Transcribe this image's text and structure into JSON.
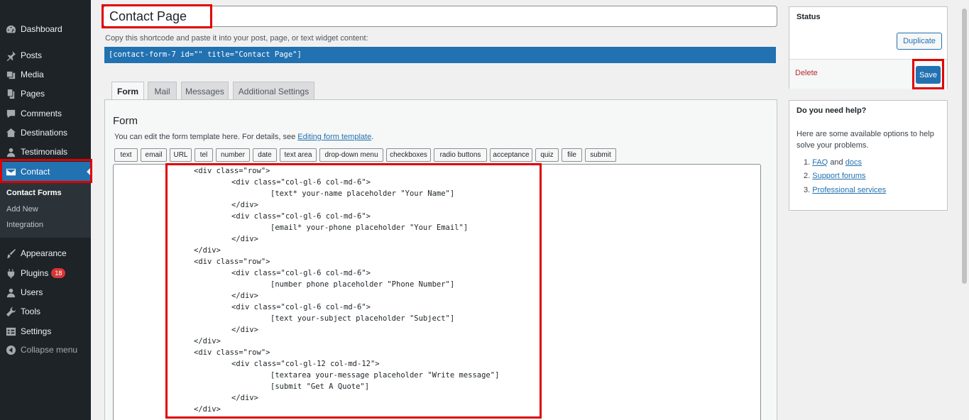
{
  "sidebar": {
    "items": [
      {
        "label": "Dashboard",
        "icon": "dashboard-icon"
      },
      {
        "label": "Posts",
        "icon": "pin-icon"
      },
      {
        "label": "Media",
        "icon": "media-icon"
      },
      {
        "label": "Pages",
        "icon": "pages-icon"
      },
      {
        "label": "Comments",
        "icon": "comment-icon"
      },
      {
        "label": "Destinations",
        "icon": "destinations-icon"
      },
      {
        "label": "Testimonials",
        "icon": "user-icon"
      },
      {
        "label": "Contact",
        "icon": "mail-icon"
      },
      {
        "label": "Appearance",
        "icon": "brush-icon"
      },
      {
        "label": "Plugins",
        "icon": "plugin-icon",
        "badge": "18"
      },
      {
        "label": "Users",
        "icon": "users-icon"
      },
      {
        "label": "Tools",
        "icon": "wrench-icon"
      },
      {
        "label": "Settings",
        "icon": "settings-icon"
      },
      {
        "label": "Collapse menu",
        "icon": "collapse-icon"
      }
    ],
    "submenu": [
      "Contact Forms",
      "Add New",
      "Integration"
    ]
  },
  "editor": {
    "title": "Contact Page",
    "shortcode_help": "Copy this shortcode and paste it into your post, page, or text widget content:",
    "shortcode": "[contact-form-7 id=\"\" title=\"Contact Page\"]",
    "tabs": [
      "Form",
      "Mail",
      "Messages",
      "Additional Settings"
    ],
    "form_heading": "Form",
    "form_desc_prefix": "You can edit the form template here. For details, see ",
    "form_desc_link": "Editing form template",
    "form_desc_suffix": ".",
    "tag_buttons": [
      "text",
      "email",
      "URL",
      "tel",
      "number",
      "date",
      "text area",
      "drop-down menu",
      "checkboxes",
      "radio buttons",
      "acceptance",
      "quiz",
      "file",
      "submit"
    ],
    "code_lines": [
      "<div class=\"row\">",
      "<div class=\"col-gl-6 col-md-6\">",
      "[text* your-name placeholder \"Your Name\"]",
      "</div>",
      "<div class=\"col-gl-6 col-md-6\">",
      "[email* your-phone placeholder \"Your Email\"]",
      "</div>",
      "</div>",
      "<div class=\"row\">",
      "<div class=\"col-gl-6 col-md-6\">",
      "[number phone placeholder \"Phone Number\"]",
      "</div>",
      "<div class=\"col-gl-6 col-md-6\">",
      "[text your-subject placeholder \"Subject\"]",
      "</div>",
      "</div>",
      "<div class=\"row\">",
      "<div class=\"col-gl-12 col-md-12\">",
      "[textarea your-message placeholder \"Write message\"]",
      "[submit \"Get A Quote\"]",
      "</div>",
      "</div>"
    ]
  },
  "status": {
    "title": "Status",
    "duplicate": "Duplicate",
    "delete": "Delete",
    "save": "Save"
  },
  "help": {
    "title": "Do you need help?",
    "text": "Here are some available options to help solve your problems.",
    "faq": "FAQ",
    "and": "and",
    "docs": "docs",
    "support": "Support forums",
    "professional": "Professional services"
  },
  "colors": {
    "accent": "#2271b1",
    "sidebar": "#1d2327",
    "highlight": "#e00000",
    "delete": "#b32d2e",
    "badge": "#d63638"
  }
}
